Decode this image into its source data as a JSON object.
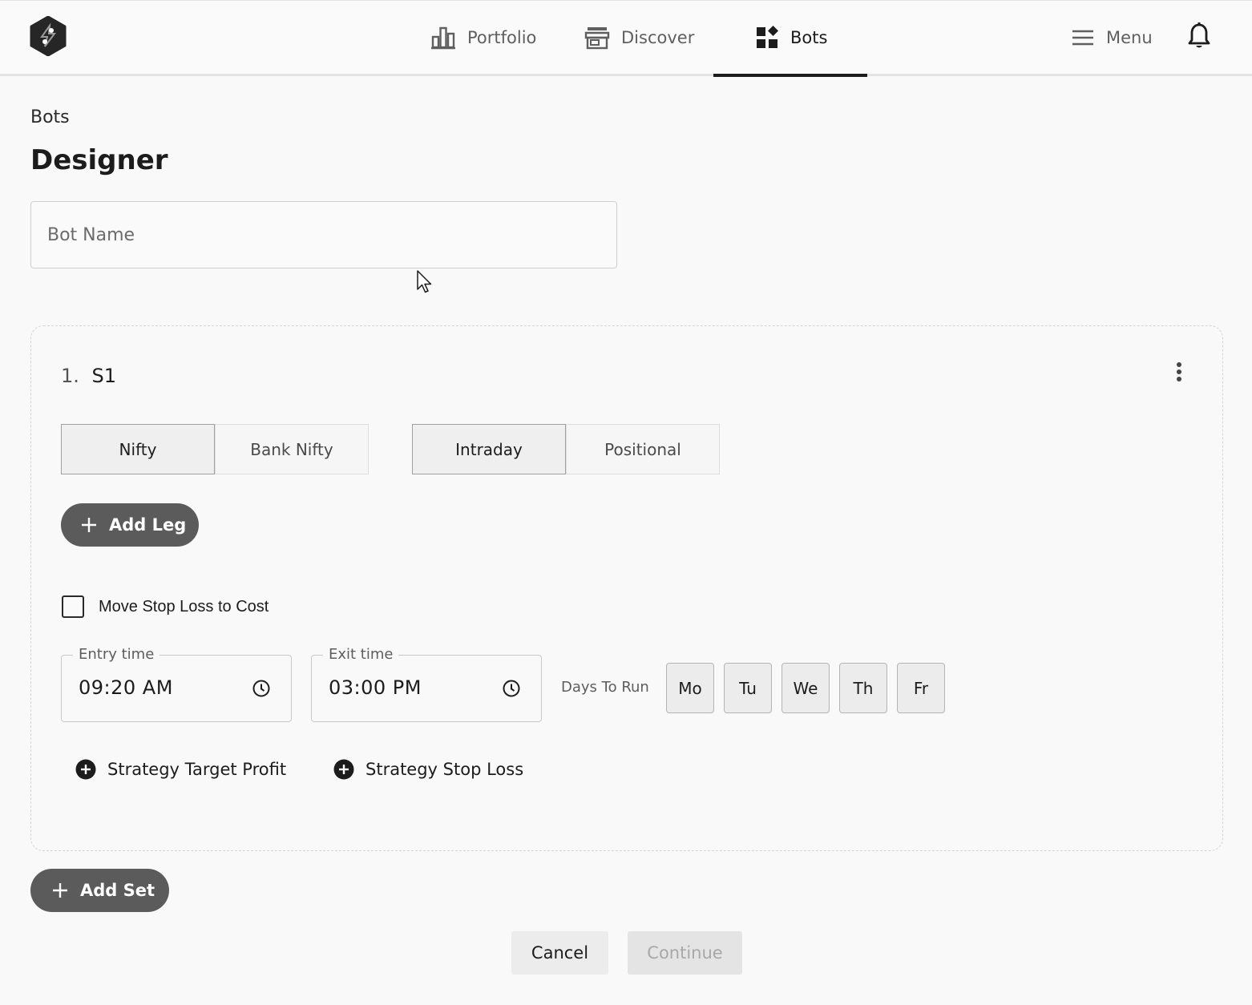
{
  "nav": {
    "portfolio": "Portfolio",
    "discover": "Discover",
    "bots": "Bots",
    "menu": "Menu",
    "active": "Bots"
  },
  "breadcrumb": "Bots",
  "page_title": "Designer",
  "bot_name": {
    "placeholder": "Bot Name",
    "value": ""
  },
  "set": {
    "number": "1.",
    "name": "S1",
    "index_options": [
      {
        "label": "Nifty",
        "selected": true
      },
      {
        "label": "Bank Nifty",
        "selected": false
      }
    ],
    "type_options": [
      {
        "label": "Intraday",
        "selected": true
      },
      {
        "label": "Positional",
        "selected": false
      }
    ],
    "add_leg_label": "Add Leg",
    "move_sl_label": "Move Stop Loss to Cost",
    "move_sl_checked": false,
    "entry_time_label": "Entry time",
    "entry_time": "09:20 AM",
    "exit_time_label": "Exit time",
    "exit_time": "03:00 PM",
    "days_label": "Days To Run",
    "days": [
      "Mo",
      "Tu",
      "We",
      "Th",
      "Fr"
    ],
    "target_profit_label": "Strategy Target Profit",
    "stop_loss_label": "Strategy Stop Loss"
  },
  "add_set_label": "Add Set",
  "footer": {
    "cancel": "Cancel",
    "continue": "Continue"
  },
  "icons": {
    "logo": "hexagon-logo-icon",
    "portfolio": "bar-chart-icon",
    "discover": "store-icon",
    "bots": "widgets-icon",
    "menu": "hamburger-icon",
    "notifications": "bell-icon"
  }
}
